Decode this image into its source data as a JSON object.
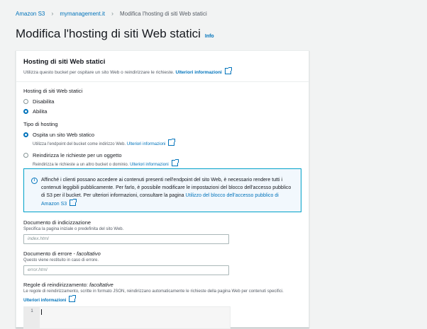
{
  "breadcrumb": {
    "items": [
      "Amazon S3",
      "mymanagement.it"
    ],
    "current": "Modifica l'hosting di siti Web statici"
  },
  "page": {
    "title": "Modifica l'hosting di siti Web statici",
    "info": "Info"
  },
  "panel": {
    "title": "Hosting di siti Web statici",
    "description": "Utilizza questo bucket per ospitare un sito Web o reindirizzare le richieste.",
    "learn_more": "Ulteriori informazioni"
  },
  "hosting": {
    "label": "Hosting di siti Web statici",
    "options": [
      {
        "label": "Disabilita",
        "selected": false
      },
      {
        "label": "Abilita",
        "selected": true
      }
    ]
  },
  "hosting_type": {
    "label": "Tipo di hosting",
    "options": [
      {
        "label": "Ospita un sito Web statico",
        "description": "Utilizza l'endpoint del bucket come indirizzo Web.",
        "link": "Ulteriori informazioni",
        "selected": true
      },
      {
        "label": "Reindirizza le richieste per un oggetto",
        "description": "Reindirizza le richieste a un altro bucket o dominio.",
        "link": "Ulteriori informazioni",
        "selected": false
      }
    ]
  },
  "alert": {
    "text": "Affinché i clienti possano accedere ai contenuti presenti nell'endpoint del sito Web, è necessario rendere tutti i contenuti leggibili pubblicamente. Per farlo, è possibile modificare le impostazioni del blocco dell'accesso pubblico di S3 per il bucket. Per ulteriori informazioni, consultare la pagina",
    "link": "Utilizzo del blocco dell'accesso pubblico di Amazon S3"
  },
  "index_doc": {
    "label": "Documento di indicizzazione",
    "description": "Specifica la pagina iniziale o predefinita del sito Web.",
    "placeholder": "index.html"
  },
  "error_doc": {
    "label": "Documento di errore - ",
    "label_optional": "facoltativo",
    "description": "Questo viene restituito in caso di errore.",
    "placeholder": "error.html"
  },
  "redirect_rules": {
    "label": "Regole di reindirizzamento: ",
    "label_optional": "facoltative",
    "description": "Le regole di reindirizzamento, scritte in formato JSON, reindirizzano automaticamente le richieste della pagina Web per contenuti specifici.",
    "link": "Ulteriori informazioni",
    "line_number": "1"
  },
  "colors": {
    "link": "#0073bb",
    "alert_border": "#00a1c9",
    "alert_bg": "#f2f8fd",
    "page_bg": "#f2f3f3"
  }
}
